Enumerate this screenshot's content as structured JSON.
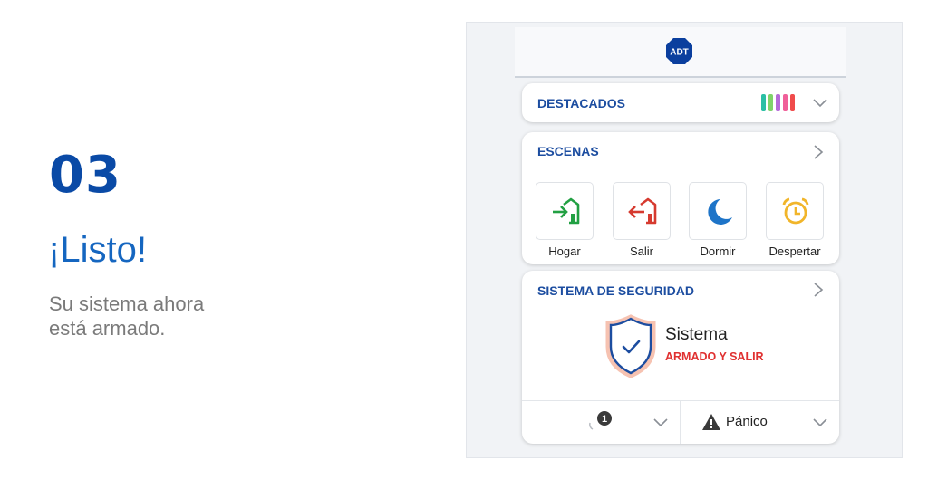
{
  "intro": {
    "step_number": "03",
    "title": "¡Listo!",
    "description_line1": "Su sistema ahora",
    "description_line2": "está armado."
  },
  "app": {
    "logo_text": "ADT",
    "highlights": {
      "title": "DESTACADOS",
      "bar_colors": [
        "#2bbfa4",
        "#7fd36a",
        "#b46ad8",
        "#f0609a",
        "#f04b4b"
      ]
    },
    "scenes": {
      "title": "ESCENAS",
      "items": [
        {
          "label": "Hogar",
          "icon": "home-arrow-in-icon",
          "color": "#22a043"
        },
        {
          "label": "Salir",
          "icon": "home-arrow-out-icon",
          "color": "#d63a2f"
        },
        {
          "label": "Dormir",
          "icon": "moon-icon",
          "color": "#1e74c8"
        },
        {
          "label": "Despertar",
          "icon": "alarm-clock-icon",
          "color": "#f1b52a"
        }
      ]
    },
    "security": {
      "title": "SISTEMA DE SEGURIDAD",
      "system_name": "Sistema",
      "status": "ARMADO Y SALIR",
      "status_color": "#e03131",
      "sensor_badge": "1",
      "panic_label": "Pánico"
    }
  }
}
